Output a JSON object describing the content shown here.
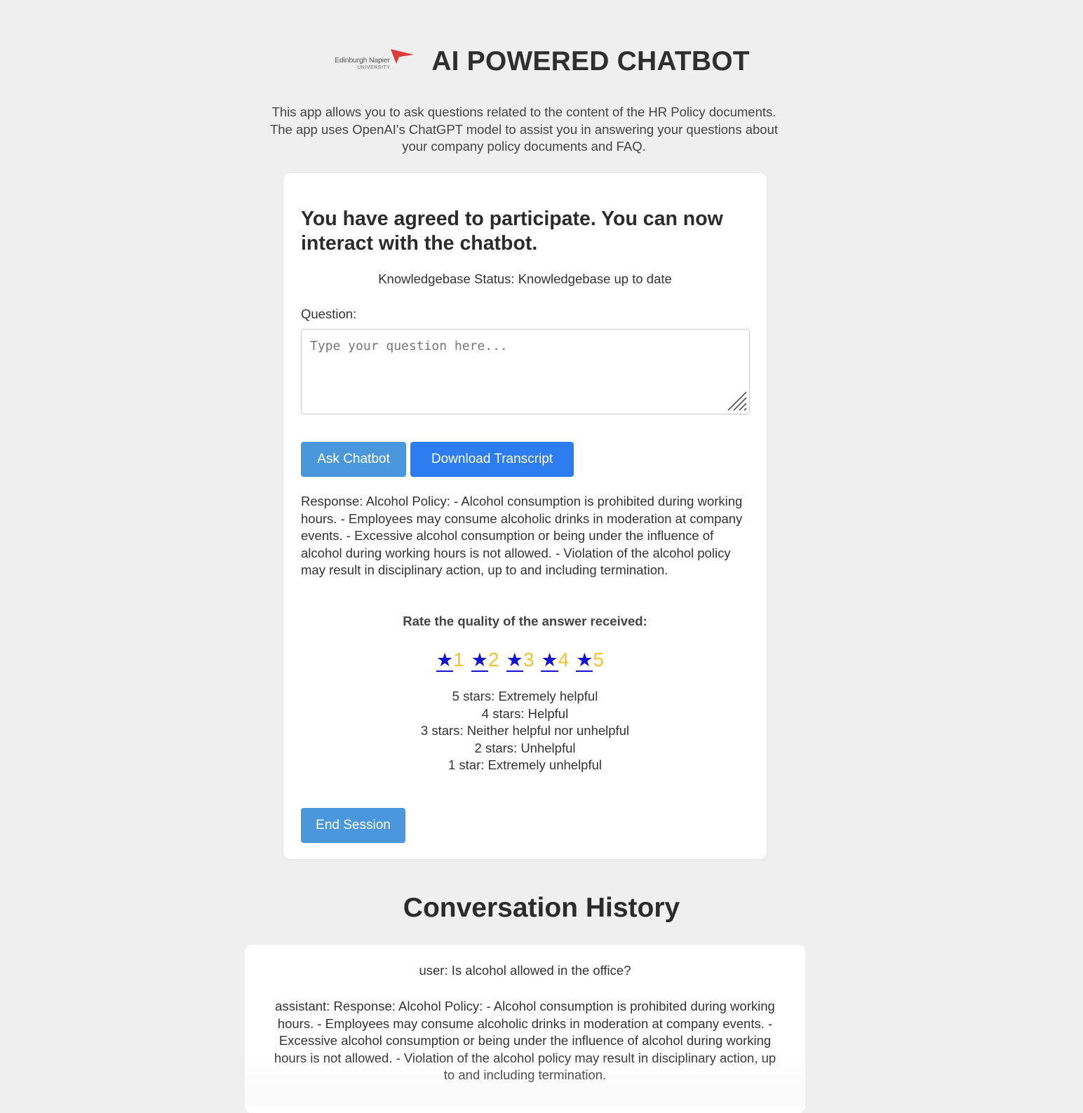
{
  "header": {
    "logo": {
      "line1": "Edinburgh Napier",
      "line2": "UNIVERSITY",
      "icon": "red-flag-logo-icon"
    },
    "title": "AI POWERED CHATBOT"
  },
  "intro": "This app allows you to ask questions related to the content of the HR Policy documents. The app uses OpenAI's ChatGPT model to assist you in answering your questions about your company policy documents and FAQ.",
  "card": {
    "title": "You have agreed to participate. You can now interact with the chatbot.",
    "kb_status": "Knowledgebase Status: Knowledgebase up to date",
    "question_label": "Question:",
    "question_placeholder": "Type your question here...",
    "question_value": "",
    "ask_label": "Ask Chatbot",
    "download_label": "Download Transcript",
    "response": "Response: Alcohol Policy: - Alcohol consumption is prohibited during working hours. - Employees may consume alcoholic drinks in moderation at company events. - Excessive alcohol consumption or being under the influence of alcohol during working hours is not allowed. - Violation of the alcohol policy may result in disciplinary action, up to and including termination.",
    "rate_label": "Rate the quality of the answer received:",
    "stars": [
      {
        "glyph": "★",
        "num": "1"
      },
      {
        "glyph": "★",
        "num": "2"
      },
      {
        "glyph": "★",
        "num": "3"
      },
      {
        "glyph": "★",
        "num": "4"
      },
      {
        "glyph": "★",
        "num": "5"
      }
    ],
    "scale": [
      "5 stars: Extremely helpful",
      "4 stars: Helpful",
      "3 stars: Neither helpful nor unhelpful",
      "2 stars: Unhelpful",
      "1 star: Extremely unhelpful"
    ],
    "end_label": "End Session"
  },
  "history": {
    "title": "Conversation History",
    "user": "user: Is alcohol allowed in the office?",
    "assistant": "assistant: Response: Alcohol Policy: - Alcohol consumption is prohibited during working hours. - Employees may consume alcoholic drinks in moderation at company events. - Excessive alcohol consumption or being under the influence of alcohol during working hours is not allowed. - Violation of the alcohol policy may result in disciplinary action, up to and including termination."
  },
  "colors": {
    "page_bg": "#efefef",
    "button_primary": "#4a98db",
    "button_download": "#2d7cf0",
    "star": "#1414d0",
    "star_number": "#f2c12e",
    "logo_red": "#e03a3e"
  }
}
